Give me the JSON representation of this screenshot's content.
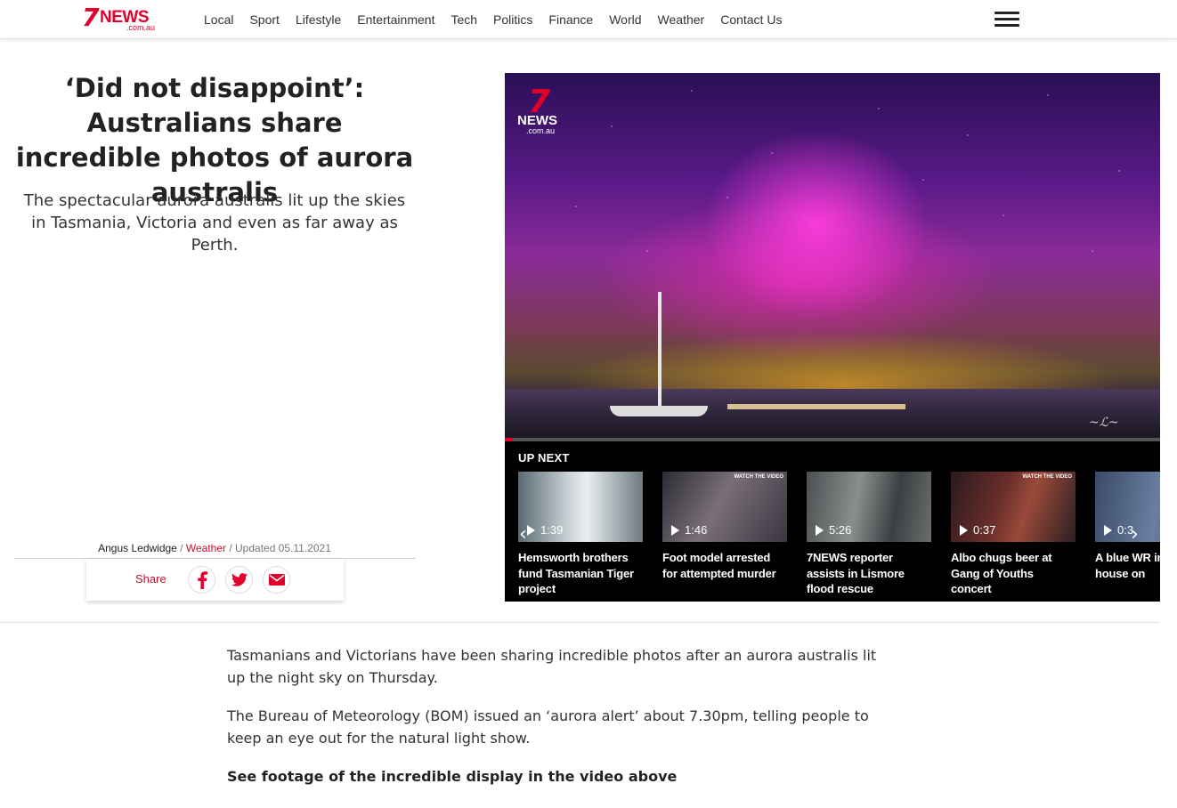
{
  "header": {
    "logo": {
      "seven": "7",
      "news": "NEWS",
      "domain": ".com.au"
    },
    "nav": [
      "Local",
      "Sport",
      "Lifestyle",
      "Entertainment",
      "Tech",
      "Politics",
      "Finance",
      "World",
      "Weather",
      "Contact Us"
    ]
  },
  "article": {
    "headline": "‘Did not disappoint’: Australians share incredible photos of aurora australis",
    "standfirst": "The spectacular aurora australis lit up the skies in Tasmania, Victoria and even as far away as Perth.",
    "author": "Angus Ledwidge",
    "section": "Weather",
    "updated": "Updated 05.11.2021",
    "share_label": "Share",
    "paragraphs": [
      "Tasmanians and Victorians have been sharing incredible photos after an aurora australis lit up the night sky on Thursday.",
      "The Bureau of Meteorology (BOM) issued an ‘aurora alert’ about 7.30pm, telling people to keep an eye out for the natural light show."
    ],
    "cta": "See footage of the incredible display in the video above"
  },
  "video": {
    "logo": {
      "seven": "7",
      "news": "NEWS",
      "domain": ".com.au"
    },
    "progress": 0.012,
    "up_next_label": "UP NEXT",
    "items": [
      {
        "duration": "1:39",
        "title": "Hemsworth brothers fund Tasmanian Tiger project"
      },
      {
        "duration": "1:46",
        "title": "Foot model arrested for attempted murder"
      },
      {
        "duration": "5:26",
        "title": "7NEWS reporter assists in Lismore flood rescue"
      },
      {
        "duration": "0:37",
        "title": "Albo chugs beer at Gang of Youths concert"
      },
      {
        "duration": "0:3",
        "title": "A blue WR into a Pia house on"
      }
    ],
    "prev_arrow": "‹",
    "next_arrow": "›"
  },
  "colors": {
    "brand_red": "#e4002b",
    "section_red": "#c8102e"
  },
  "icons": [
    "hamburger-menu-icon",
    "facebook-icon",
    "twitter-icon",
    "email-icon",
    "play-icon",
    "chevron-left-icon",
    "chevron-right-icon"
  ]
}
